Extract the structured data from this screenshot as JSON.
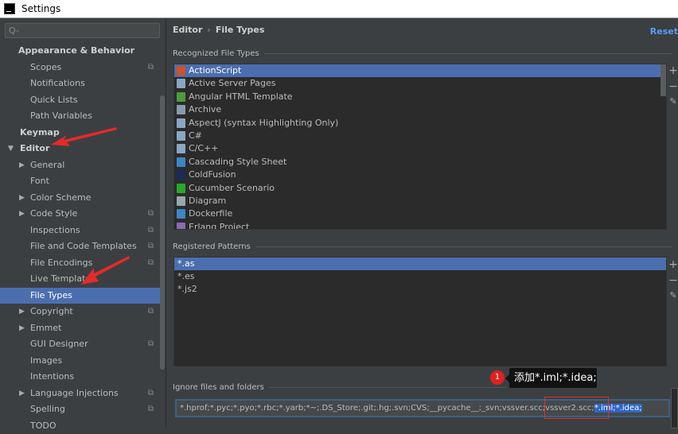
{
  "window": {
    "title": "Settings"
  },
  "search": {
    "placeholder": "Q-"
  },
  "sidebar": {
    "items": [
      {
        "label": "Appearance & Behavior",
        "level": 0,
        "bold": true
      },
      {
        "label": "Scopes",
        "level": 1,
        "copy": true
      },
      {
        "label": "Notifications",
        "level": 1
      },
      {
        "label": "Quick Lists",
        "level": 1
      },
      {
        "label": "Path Variables",
        "level": 1
      },
      {
        "label": "Keymap",
        "level": 0,
        "bold": true
      },
      {
        "label": "Editor",
        "level": 0,
        "bold": true,
        "expanded": true
      },
      {
        "label": "General",
        "level": 1,
        "collapsed": true
      },
      {
        "label": "Font",
        "level": 1
      },
      {
        "label": "Color Scheme",
        "level": 1,
        "collapsed": true
      },
      {
        "label": "Code Style",
        "level": 1,
        "collapsed": true,
        "copy": true
      },
      {
        "label": "Inspections",
        "level": 1,
        "copy": true
      },
      {
        "label": "File and Code Templates",
        "level": 1,
        "copy": true
      },
      {
        "label": "File Encodings",
        "level": 1,
        "copy": true
      },
      {
        "label": "Live Templates",
        "level": 1
      },
      {
        "label": "File Types",
        "level": 1,
        "selected": true
      },
      {
        "label": "Copyright",
        "level": 1,
        "collapsed": true,
        "copy": true
      },
      {
        "label": "Emmet",
        "level": 1,
        "collapsed": true
      },
      {
        "label": "GUI Designer",
        "level": 1,
        "copy": true
      },
      {
        "label": "Images",
        "level": 1
      },
      {
        "label": "Intentions",
        "level": 1
      },
      {
        "label": "Language Injections",
        "level": 1,
        "collapsed": true,
        "copy": true
      },
      {
        "label": "Spelling",
        "level": 1,
        "copy": true
      },
      {
        "label": "TODO",
        "level": 1
      }
    ]
  },
  "main": {
    "breadcrumb": [
      "Editor",
      "File Types"
    ],
    "reset_label": "Reset",
    "recognized_label": "Recognized File Types",
    "file_types": [
      {
        "label": "ActionScript",
        "color": "#c9542b",
        "selected": true
      },
      {
        "label": "Active Server Pages",
        "color": "#8aa6c0"
      },
      {
        "label": "Angular HTML Template",
        "color": "#4f9a3a"
      },
      {
        "label": "Archive",
        "color": "#8a9aa8"
      },
      {
        "label": "AspectJ (syntax Highlighting Only)",
        "color": "#8aa6c0"
      },
      {
        "label": "C#",
        "color": "#8aa6c0"
      },
      {
        "label": "C/C++",
        "color": "#8aa6c0"
      },
      {
        "label": "Cascading Style Sheet",
        "color": "#3d86c6"
      },
      {
        "label": "ColdFusion",
        "color": "#1c2a55"
      },
      {
        "label": "Cucumber Scenario",
        "color": "#2aa82a"
      },
      {
        "label": "Diagram",
        "color": "#9aa5ad"
      },
      {
        "label": "Dockerfile",
        "color": "#3d86c6"
      },
      {
        "label": "Erlang Project",
        "color": "#8a6ab0"
      }
    ],
    "registered_label": "Registered Patterns",
    "patterns": [
      {
        "label": "*.as",
        "selected": true
      },
      {
        "label": "*.es"
      },
      {
        "label": "*.js2"
      }
    ],
    "ignore_label": "Ignore files and folders",
    "ignore_value": "*.hprof;*.pyc;*.pyo;*.rbc;*.yarb;*~;.DS_Store;.git;.hg;.svn;CVS;__pycache__;_svn;vssver.scc;vssver2.scc;",
    "ignore_selected": "*.iml;*.idea;"
  },
  "annotation": {
    "badge": "1",
    "tooltip": "添加*.iml;*.idea;",
    "color": "#e02020"
  },
  "colors": {
    "accent": "#4b6eaf",
    "background": "#3c3f41",
    "link": "#589df6"
  }
}
